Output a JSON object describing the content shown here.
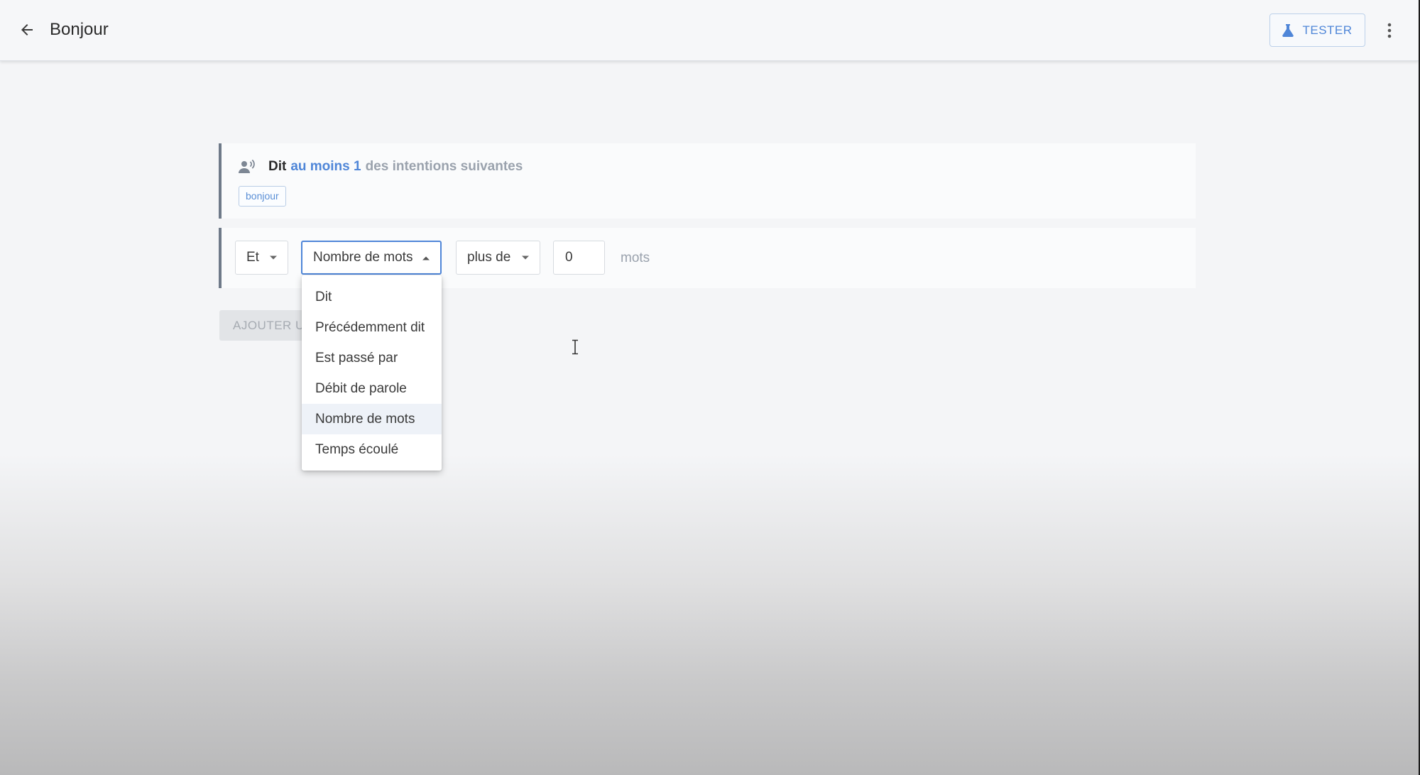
{
  "header": {
    "title": "Bonjour",
    "tester_label": "TESTER"
  },
  "intent_card": {
    "verb": "Dit",
    "quantifier": "au moins 1",
    "suffix": "des intentions suivantes",
    "tags": [
      "bonjour"
    ]
  },
  "condition": {
    "conjunction": "Et",
    "metric": "Nombre de mots",
    "operator": "plus de",
    "value": "0",
    "unit": "mots"
  },
  "add_button_label": "AJOUTER U",
  "metric_dropdown": {
    "options": [
      "Dit",
      "Précédemment dit",
      "Est passé par",
      "Débit de parole",
      "Nombre de mots",
      "Temps écoulé"
    ],
    "selected": "Nombre de mots"
  },
  "colors": {
    "accent": "#4f86d8",
    "muted_text": "#9aa2ad",
    "card_border": "#6f7a89"
  },
  "icons": {
    "back": "arrow-left-icon",
    "tester": "flask-icon",
    "more": "more-vertical-icon",
    "speaker": "speaking-person-icon",
    "caret": "caret-down-icon"
  }
}
